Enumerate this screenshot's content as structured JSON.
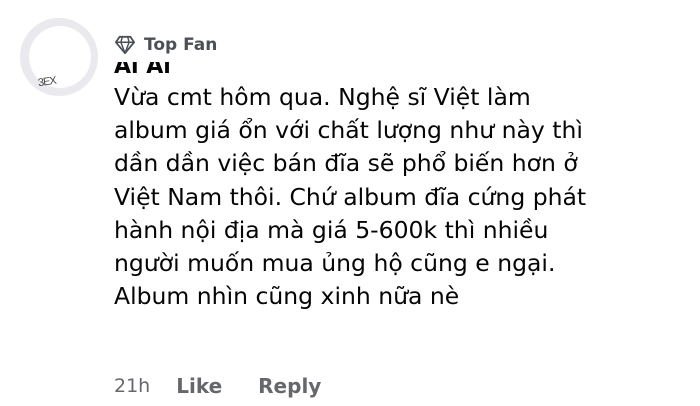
{
  "avatar": {
    "scribble": "3EX"
  },
  "badge": {
    "icon": "diamond-icon",
    "label": "Top Fan"
  },
  "author": {
    "name": "Ai Ai"
  },
  "comment": {
    "lines": [
      "Vừa cmt hôm qua. Nghệ sĩ Việt làm",
      "album giá ổn với chất lượng như này thì",
      "dần dần việc bán đĩa sẽ phổ biến hơn ở",
      "Việt Nam thôi. Chứ album đĩa cứng phát",
      "hành nội địa mà giá 5-600k thì nhiều",
      "người muốn mua ủng hộ cũng e ngại.",
      "Album nhìn cũng xinh nữa nè"
    ]
  },
  "actions": {
    "time": "21h",
    "like_label": "Like",
    "reply_label": "Reply"
  }
}
